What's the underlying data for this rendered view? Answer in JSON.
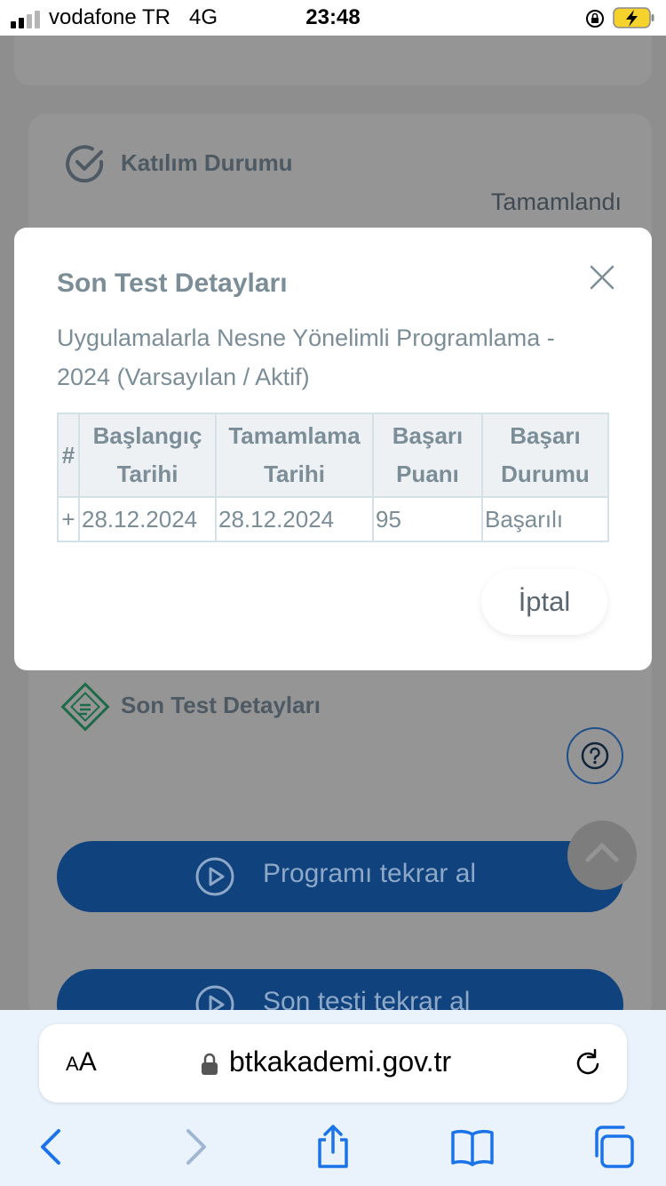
{
  "status_bar": {
    "carrier": "vodafone TR",
    "network": "4G",
    "time": "23:48"
  },
  "page": {
    "katilim_label": "Katılım Durumu",
    "katilim_value": "Tamamlandı",
    "son_test_label": "Son Test Detayları",
    "retake_program_label": "Programı tekrar al",
    "retake_test_label": "Son testi tekrar al"
  },
  "modal": {
    "title": "Son Test Detayları",
    "subtitle": "Uygulamalarla Nesne Yönelimli Programlama - 2024 (Varsayılan / Aktif)",
    "table": {
      "headers": [
        "#",
        "Başlangıç Tarihi",
        "Tamamlama Tarihi",
        "Başarı Puanı",
        "Başarı Durumu"
      ],
      "rows": [
        [
          "+",
          "28.12.2024",
          "28.12.2024",
          "95",
          "Başarılı"
        ]
      ]
    },
    "cancel_label": "İptal"
  },
  "browser": {
    "aa_small": "A",
    "aa_big": "A",
    "url": "btkakademi.gov.tr"
  },
  "colors": {
    "modal_text": "#7b8d97",
    "primary_button": "#10427e",
    "table_border": "#d4e2e8",
    "overlay": "#8e8e8e"
  }
}
